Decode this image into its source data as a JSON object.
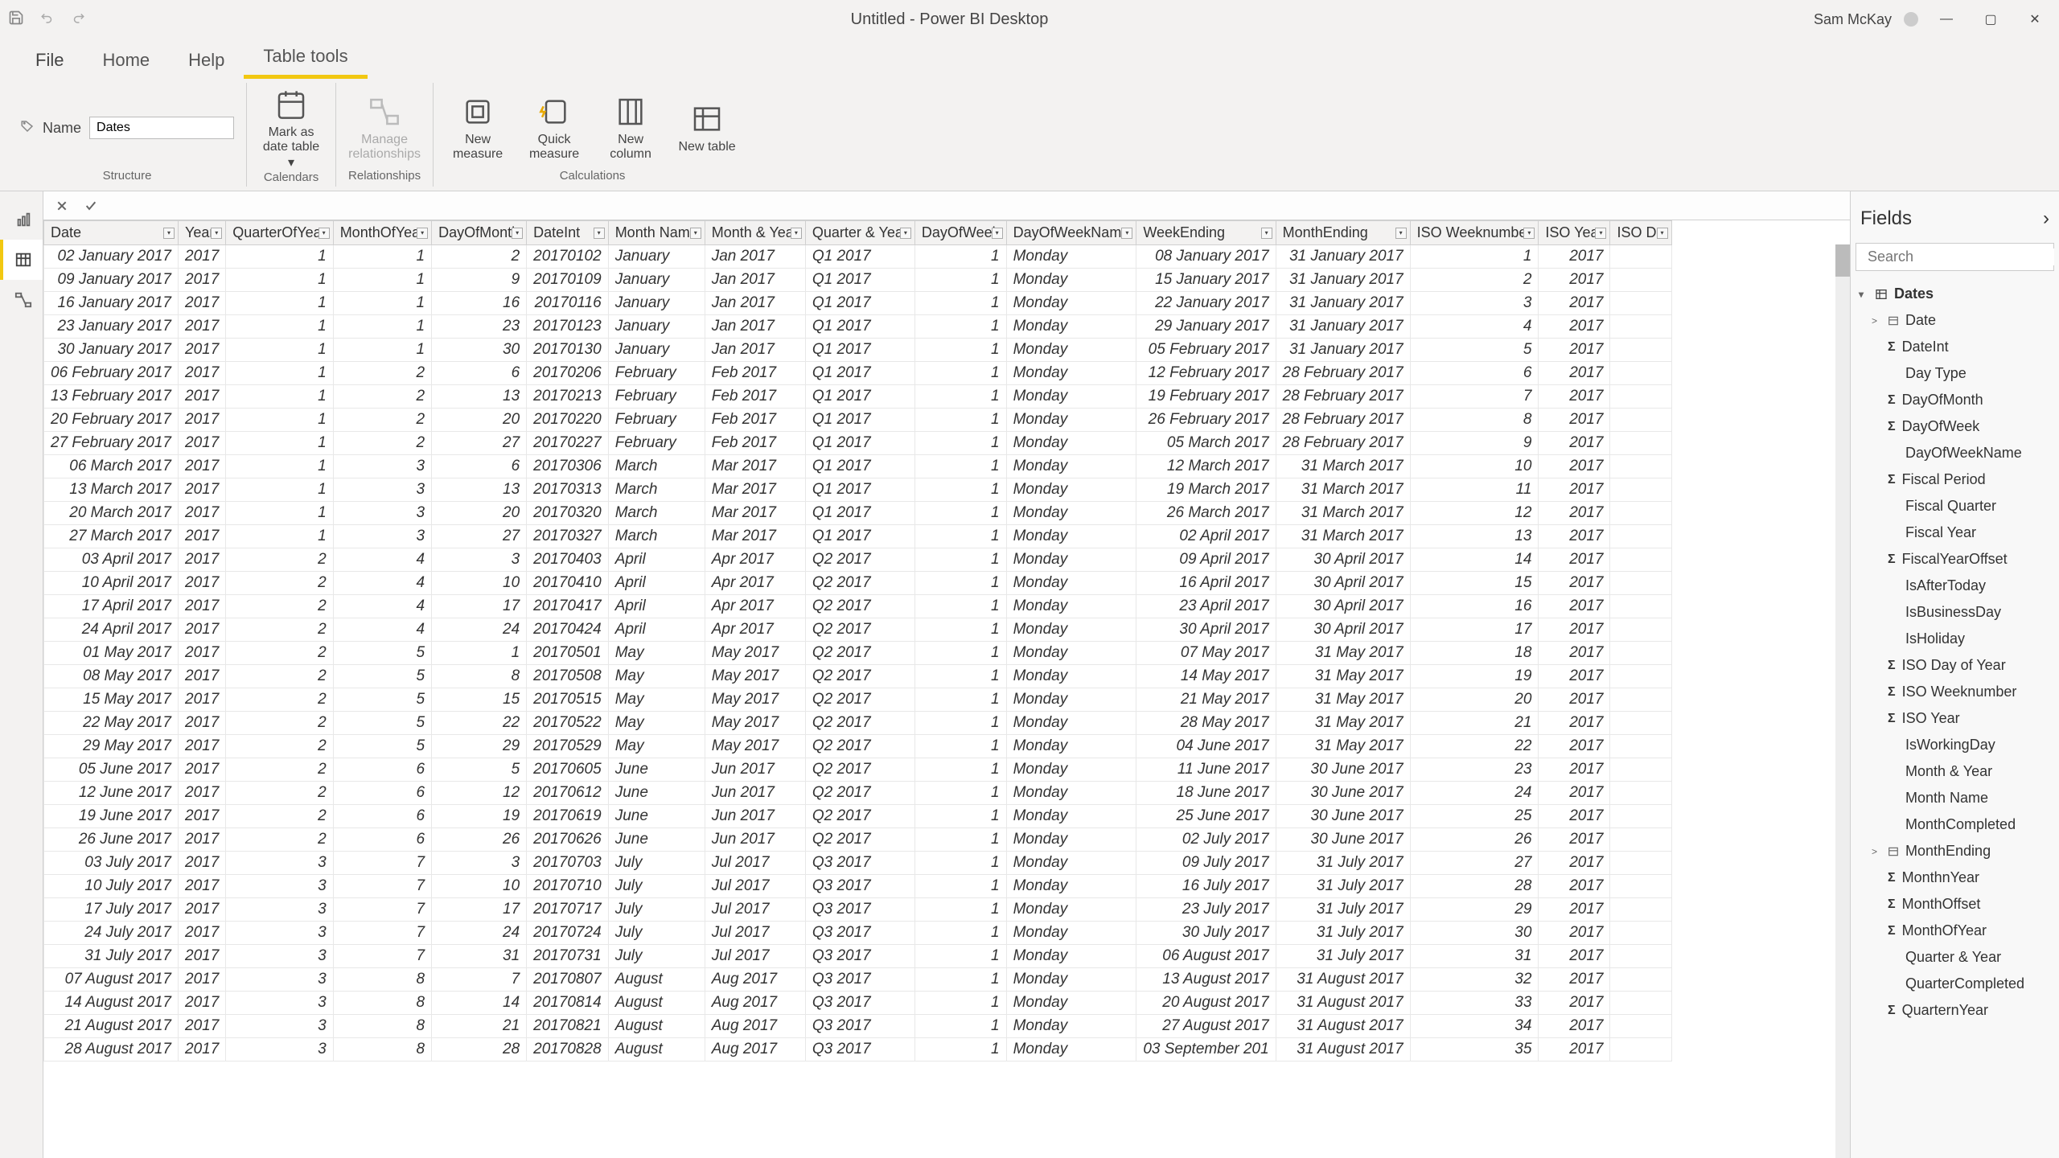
{
  "title": "Untitled - Power BI Desktop",
  "user": "Sam McKay",
  "tabs": {
    "file": "File",
    "home": "Home",
    "help": "Help",
    "table_tools": "Table tools"
  },
  "structure": {
    "name_label": "Name",
    "name_value": "Dates",
    "group": "Structure"
  },
  "calendars": {
    "mark": "Mark as date table ▾",
    "group": "Calendars"
  },
  "relationships": {
    "manage": "Manage relationships",
    "group": "Relationships"
  },
  "calculations": {
    "new_measure": "New measure",
    "quick_measure": "Quick measure",
    "new_column": "New column",
    "new_table": "New table",
    "group": "Calculations"
  },
  "fields_panel": {
    "title": "Fields",
    "search_placeholder": "Search",
    "table": "Dates",
    "items": [
      {
        "n": "Date",
        "icon": "table",
        "expand": ">"
      },
      {
        "n": "DateInt",
        "sigma": true
      },
      {
        "n": "Day Type"
      },
      {
        "n": "DayOfMonth",
        "sigma": true
      },
      {
        "n": "DayOfWeek",
        "sigma": true
      },
      {
        "n": "DayOfWeekName"
      },
      {
        "n": "Fiscal Period",
        "sigma": true
      },
      {
        "n": "Fiscal Quarter"
      },
      {
        "n": "Fiscal Year"
      },
      {
        "n": "FiscalYearOffset",
        "sigma": true
      },
      {
        "n": "IsAfterToday"
      },
      {
        "n": "IsBusinessDay"
      },
      {
        "n": "IsHoliday"
      },
      {
        "n": "ISO Day of Year",
        "sigma": true
      },
      {
        "n": "ISO Weeknumber",
        "sigma": true
      },
      {
        "n": "ISO Year",
        "sigma": true
      },
      {
        "n": "IsWorkingDay"
      },
      {
        "n": "Month & Year"
      },
      {
        "n": "Month Name"
      },
      {
        "n": "MonthCompleted"
      },
      {
        "n": "MonthEnding",
        "icon": "table",
        "expand": ">"
      },
      {
        "n": "MonthnYear",
        "sigma": true
      },
      {
        "n": "MonthOffset",
        "sigma": true
      },
      {
        "n": "MonthOfYear",
        "sigma": true
      },
      {
        "n": "Quarter & Year"
      },
      {
        "n": "QuarterCompleted"
      },
      {
        "n": "QuarternYear",
        "sigma": true
      }
    ]
  },
  "columns": [
    "Date",
    "Year",
    "QuarterOfYear",
    "MonthOfYear",
    "DayOfMonth",
    "DateInt",
    "Month Name",
    "Month & Year",
    "Quarter & Year",
    "DayOfWeek",
    "DayOfWeekName",
    "WeekEnding",
    "MonthEnding",
    "ISO Weeknumber",
    "ISO Year",
    "ISO Da"
  ],
  "align": [
    "r",
    "r",
    "r",
    "r",
    "r",
    "r",
    "l",
    "l",
    "l",
    "r",
    "l",
    "r",
    "r",
    "r",
    "r",
    "l"
  ],
  "rows": [
    [
      "02 January 2017",
      "2017",
      "1",
      "1",
      "2",
      "20170102",
      "January",
      "Jan 2017",
      "Q1 2017",
      "1",
      "Monday",
      "08 January 2017",
      "31 January 2017",
      "1",
      "2017",
      ""
    ],
    [
      "09 January 2017",
      "2017",
      "1",
      "1",
      "9",
      "20170109",
      "January",
      "Jan 2017",
      "Q1 2017",
      "1",
      "Monday",
      "15 January 2017",
      "31 January 2017",
      "2",
      "2017",
      ""
    ],
    [
      "16 January 2017",
      "2017",
      "1",
      "1",
      "16",
      "20170116",
      "January",
      "Jan 2017",
      "Q1 2017",
      "1",
      "Monday",
      "22 January 2017",
      "31 January 2017",
      "3",
      "2017",
      ""
    ],
    [
      "23 January 2017",
      "2017",
      "1",
      "1",
      "23",
      "20170123",
      "January",
      "Jan 2017",
      "Q1 2017",
      "1",
      "Monday",
      "29 January 2017",
      "31 January 2017",
      "4",
      "2017",
      ""
    ],
    [
      "30 January 2017",
      "2017",
      "1",
      "1",
      "30",
      "20170130",
      "January",
      "Jan 2017",
      "Q1 2017",
      "1",
      "Monday",
      "05 February 2017",
      "31 January 2017",
      "5",
      "2017",
      ""
    ],
    [
      "06 February 2017",
      "2017",
      "1",
      "2",
      "6",
      "20170206",
      "February",
      "Feb 2017",
      "Q1 2017",
      "1",
      "Monday",
      "12 February 2017",
      "28 February 2017",
      "6",
      "2017",
      ""
    ],
    [
      "13 February 2017",
      "2017",
      "1",
      "2",
      "13",
      "20170213",
      "February",
      "Feb 2017",
      "Q1 2017",
      "1",
      "Monday",
      "19 February 2017",
      "28 February 2017",
      "7",
      "2017",
      ""
    ],
    [
      "20 February 2017",
      "2017",
      "1",
      "2",
      "20",
      "20170220",
      "February",
      "Feb 2017",
      "Q1 2017",
      "1",
      "Monday",
      "26 February 2017",
      "28 February 2017",
      "8",
      "2017",
      ""
    ],
    [
      "27 February 2017",
      "2017",
      "1",
      "2",
      "27",
      "20170227",
      "February",
      "Feb 2017",
      "Q1 2017",
      "1",
      "Monday",
      "05 March 2017",
      "28 February 2017",
      "9",
      "2017",
      ""
    ],
    [
      "06 March 2017",
      "2017",
      "1",
      "3",
      "6",
      "20170306",
      "March",
      "Mar 2017",
      "Q1 2017",
      "1",
      "Monday",
      "12 March 2017",
      "31 March 2017",
      "10",
      "2017",
      ""
    ],
    [
      "13 March 2017",
      "2017",
      "1",
      "3",
      "13",
      "20170313",
      "March",
      "Mar 2017",
      "Q1 2017",
      "1",
      "Monday",
      "19 March 2017",
      "31 March 2017",
      "11",
      "2017",
      ""
    ],
    [
      "20 March 2017",
      "2017",
      "1",
      "3",
      "20",
      "20170320",
      "March",
      "Mar 2017",
      "Q1 2017",
      "1",
      "Monday",
      "26 March 2017",
      "31 March 2017",
      "12",
      "2017",
      ""
    ],
    [
      "27 March 2017",
      "2017",
      "1",
      "3",
      "27",
      "20170327",
      "March",
      "Mar 2017",
      "Q1 2017",
      "1",
      "Monday",
      "02 April 2017",
      "31 March 2017",
      "13",
      "2017",
      ""
    ],
    [
      "03 April 2017",
      "2017",
      "2",
      "4",
      "3",
      "20170403",
      "April",
      "Apr 2017",
      "Q2 2017",
      "1",
      "Monday",
      "09 April 2017",
      "30 April 2017",
      "14",
      "2017",
      ""
    ],
    [
      "10 April 2017",
      "2017",
      "2",
      "4",
      "10",
      "20170410",
      "April",
      "Apr 2017",
      "Q2 2017",
      "1",
      "Monday",
      "16 April 2017",
      "30 April 2017",
      "15",
      "2017",
      ""
    ],
    [
      "17 April 2017",
      "2017",
      "2",
      "4",
      "17",
      "20170417",
      "April",
      "Apr 2017",
      "Q2 2017",
      "1",
      "Monday",
      "23 April 2017",
      "30 April 2017",
      "16",
      "2017",
      ""
    ],
    [
      "24 April 2017",
      "2017",
      "2",
      "4",
      "24",
      "20170424",
      "April",
      "Apr 2017",
      "Q2 2017",
      "1",
      "Monday",
      "30 April 2017",
      "30 April 2017",
      "17",
      "2017",
      ""
    ],
    [
      "01 May 2017",
      "2017",
      "2",
      "5",
      "1",
      "20170501",
      "May",
      "May 2017",
      "Q2 2017",
      "1",
      "Monday",
      "07 May 2017",
      "31 May 2017",
      "18",
      "2017",
      ""
    ],
    [
      "08 May 2017",
      "2017",
      "2",
      "5",
      "8",
      "20170508",
      "May",
      "May 2017",
      "Q2 2017",
      "1",
      "Monday",
      "14 May 2017",
      "31 May 2017",
      "19",
      "2017",
      ""
    ],
    [
      "15 May 2017",
      "2017",
      "2",
      "5",
      "15",
      "20170515",
      "May",
      "May 2017",
      "Q2 2017",
      "1",
      "Monday",
      "21 May 2017",
      "31 May 2017",
      "20",
      "2017",
      ""
    ],
    [
      "22 May 2017",
      "2017",
      "2",
      "5",
      "22",
      "20170522",
      "May",
      "May 2017",
      "Q2 2017",
      "1",
      "Monday",
      "28 May 2017",
      "31 May 2017",
      "21",
      "2017",
      ""
    ],
    [
      "29 May 2017",
      "2017",
      "2",
      "5",
      "29",
      "20170529",
      "May",
      "May 2017",
      "Q2 2017",
      "1",
      "Monday",
      "04 June 2017",
      "31 May 2017",
      "22",
      "2017",
      ""
    ],
    [
      "05 June 2017",
      "2017",
      "2",
      "6",
      "5",
      "20170605",
      "June",
      "Jun 2017",
      "Q2 2017",
      "1",
      "Monday",
      "11 June 2017",
      "30 June 2017",
      "23",
      "2017",
      ""
    ],
    [
      "12 June 2017",
      "2017",
      "2",
      "6",
      "12",
      "20170612",
      "June",
      "Jun 2017",
      "Q2 2017",
      "1",
      "Monday",
      "18 June 2017",
      "30 June 2017",
      "24",
      "2017",
      ""
    ],
    [
      "19 June 2017",
      "2017",
      "2",
      "6",
      "19",
      "20170619",
      "June",
      "Jun 2017",
      "Q2 2017",
      "1",
      "Monday",
      "25 June 2017",
      "30 June 2017",
      "25",
      "2017",
      ""
    ],
    [
      "26 June 2017",
      "2017",
      "2",
      "6",
      "26",
      "20170626",
      "June",
      "Jun 2017",
      "Q2 2017",
      "1",
      "Monday",
      "02 July 2017",
      "30 June 2017",
      "26",
      "2017",
      ""
    ],
    [
      "03 July 2017",
      "2017",
      "3",
      "7",
      "3",
      "20170703",
      "July",
      "Jul 2017",
      "Q3 2017",
      "1",
      "Monday",
      "09 July 2017",
      "31 July 2017",
      "27",
      "2017",
      ""
    ],
    [
      "10 July 2017",
      "2017",
      "3",
      "7",
      "10",
      "20170710",
      "July",
      "Jul 2017",
      "Q3 2017",
      "1",
      "Monday",
      "16 July 2017",
      "31 July 2017",
      "28",
      "2017",
      ""
    ],
    [
      "17 July 2017",
      "2017",
      "3",
      "7",
      "17",
      "20170717",
      "July",
      "Jul 2017",
      "Q3 2017",
      "1",
      "Monday",
      "23 July 2017",
      "31 July 2017",
      "29",
      "2017",
      ""
    ],
    [
      "24 July 2017",
      "2017",
      "3",
      "7",
      "24",
      "20170724",
      "July",
      "Jul 2017",
      "Q3 2017",
      "1",
      "Monday",
      "30 July 2017",
      "31 July 2017",
      "30",
      "2017",
      ""
    ],
    [
      "31 July 2017",
      "2017",
      "3",
      "7",
      "31",
      "20170731",
      "July",
      "Jul 2017",
      "Q3 2017",
      "1",
      "Monday",
      "06 August 2017",
      "31 July 2017",
      "31",
      "2017",
      ""
    ],
    [
      "07 August 2017",
      "2017",
      "3",
      "8",
      "7",
      "20170807",
      "August",
      "Aug 2017",
      "Q3 2017",
      "1",
      "Monday",
      "13 August 2017",
      "31 August 2017",
      "32",
      "2017",
      ""
    ],
    [
      "14 August 2017",
      "2017",
      "3",
      "8",
      "14",
      "20170814",
      "August",
      "Aug 2017",
      "Q3 2017",
      "1",
      "Monday",
      "20 August 2017",
      "31 August 2017",
      "33",
      "2017",
      ""
    ],
    [
      "21 August 2017",
      "2017",
      "3",
      "8",
      "21",
      "20170821",
      "August",
      "Aug 2017",
      "Q3 2017",
      "1",
      "Monday",
      "27 August 2017",
      "31 August 2017",
      "34",
      "2017",
      ""
    ],
    [
      "28 August 2017",
      "2017",
      "3",
      "8",
      "28",
      "20170828",
      "August",
      "Aug 2017",
      "Q3 2017",
      "1",
      "Monday",
      "03 September 201",
      "31 August 2017",
      "35",
      "2017",
      ""
    ]
  ]
}
